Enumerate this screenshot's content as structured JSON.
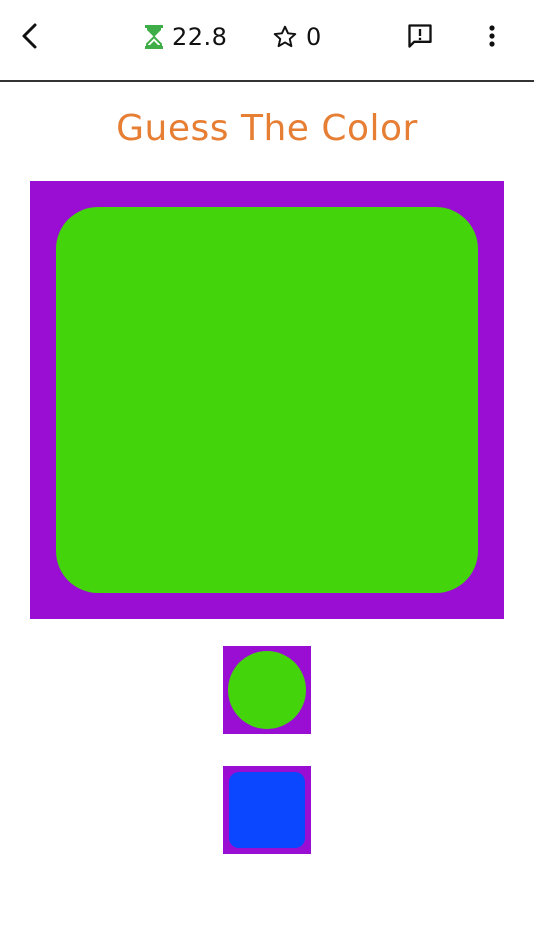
{
  "header": {
    "timer_value": "22.8",
    "score_value": "0",
    "icons": {
      "back": "chevron-left-icon",
      "timer": "hourglass-icon",
      "score": "star-outline-icon",
      "feedback": "feedback-icon",
      "more": "more-vert-icon"
    }
  },
  "game": {
    "title": "Guess The Color",
    "target": {
      "frame_color": "#9a0ed3",
      "shape_color": "#43d40c",
      "shape": "rounded-square"
    },
    "options": [
      {
        "frame_color": "#9a0ed3",
        "shape_color": "#43d40c",
        "shape": "circle"
      },
      {
        "frame_color": "#9a0ed3",
        "shape_color": "#0b47ff",
        "shape": "rounded-square"
      }
    ]
  },
  "colors": {
    "title": "#e67e34",
    "timer_icon": "#3fae49",
    "divider": "#333333"
  }
}
